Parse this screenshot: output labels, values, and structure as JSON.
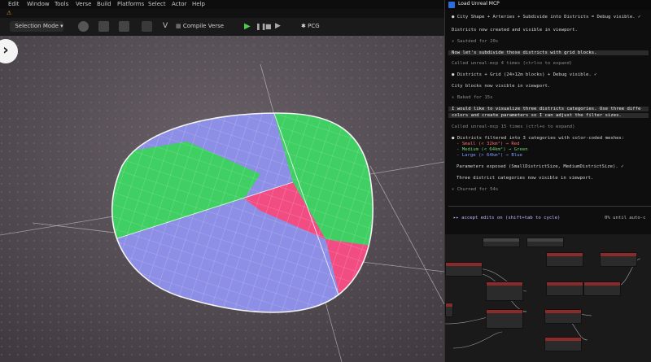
{
  "menubar": {
    "items": [
      "Edit",
      "Window",
      "Tools",
      "Verse",
      "Build",
      "Platforms",
      "Select",
      "Actor",
      "Help"
    ],
    "warning": "⚠"
  },
  "toolbar": {
    "selection_mode": "Selection Mode",
    "compile": "Compile Verse",
    "pcg": "PCG"
  },
  "viewport": {
    "nav_icon": "chevron-right-icon"
  },
  "terminal": {
    "title": "Load Unreal MCP",
    "lines": [
      "● City Shape + Arteries + Subdivide into Districts = Debug visible. ✓",
      "Districts now created and visible in viewport.",
      "✳ Sautéed for 20s",
      "Now let's subdivide those districts with grid blocks.",
      "Called unreal-mcp 4 times (ctrl+o to expand)",
      "● Districts + Grid (24×12m blocks) + Debug visible. ✓",
      "City blocks now visible in viewport.",
      "✳ Baked for 15s",
      "I would like to visualize three districts categories. Use three diffe",
      "colors and create parameters so I can adjust the filter sizes.",
      "Called unreal-mcp 15 times (ctrl+o to expand)",
      "● Districts filtered into 3 categories with color-coded meshes:",
      "- Small (< 32km²) → Red",
      "- Medium (< 64km²) → Green",
      "- Large (> 64km²) → Blue",
      "Parameters exposed (SmallDistrictSize, MediumDistrictSize). ✓",
      "Three district categories now visible in viewport.",
      "✳ Churned for 54s"
    ],
    "prompt": "▸▸ accept edits on (shift+tab to cycle)",
    "prompt_right": "0% until auto-c"
  },
  "colors": {
    "blue": "#8d8fe6",
    "green": "#3fcf63",
    "red": "#f24d83",
    "terminal_bg": "#0e0e0e",
    "viewport_bg": "#5a5258"
  }
}
